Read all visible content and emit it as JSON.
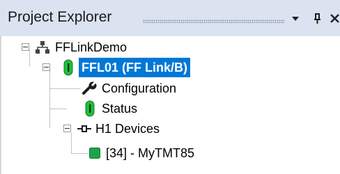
{
  "panel": {
    "title": "Project Explorer",
    "buttons": {
      "dropdown_icon": "chevron-down-icon",
      "pin_icon": "pin-icon",
      "close_icon": "close-icon"
    }
  },
  "tree": {
    "root": {
      "label": "FFLinkDemo",
      "icon": "network-icon",
      "expanded": true
    },
    "device": {
      "label": "FFL01 (FF Link/B)",
      "icon": "status-green-icon",
      "expanded": true,
      "selected": true
    },
    "configuration": {
      "label": "Configuration",
      "icon": "wrench-icon"
    },
    "status": {
      "label": "Status",
      "icon": "status-green-icon"
    },
    "h1_devices": {
      "label": "H1 Devices",
      "icon": "bus-connector-icon",
      "expanded": true
    },
    "field_device": {
      "label": "[34] - MyTMT85",
      "icon": "green-square-icon"
    }
  },
  "colors": {
    "title_bar": "#dbe3f1",
    "selection": "#0078d7",
    "status_green": "#1fbf3a"
  }
}
